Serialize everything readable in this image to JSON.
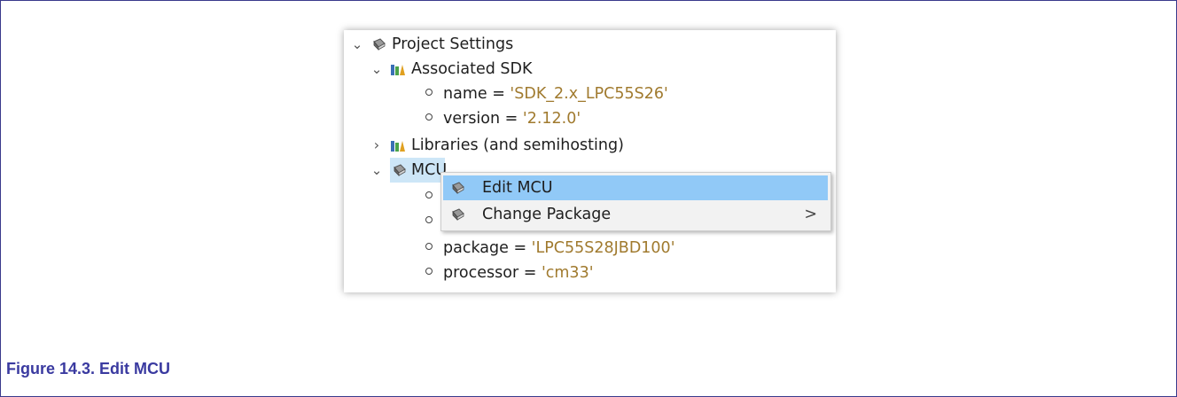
{
  "tree": {
    "project_settings": "Project Settings",
    "associated_sdk": "Associated SDK",
    "sdk_name_key": "name = ",
    "sdk_name_val": "'SDK_2.x_LPC55S26'",
    "sdk_version_key": "version = ",
    "sdk_version_val": "'2.12.0'",
    "libraries": "Libraries (and semihosting)",
    "mcu": "MCU",
    "package_key": "package = ",
    "package_val": "'LPC55S28JBD100'",
    "processor_key": "processor = ",
    "processor_val": "'cm33'"
  },
  "context_menu": {
    "items": [
      {
        "label": "Edit MCU",
        "icon": "book-icon",
        "active": true
      },
      {
        "label": "Change Package",
        "icon": "book-icon",
        "has_submenu": true
      }
    ],
    "submenu_arrow": ">"
  },
  "caption": "Figure 14.3. Edit MCU",
  "colors": {
    "value_text": "#a07a2e",
    "menu_highlight": "#91c9f7",
    "selection": "#cde6f7",
    "caption": "#3a3aa0"
  }
}
